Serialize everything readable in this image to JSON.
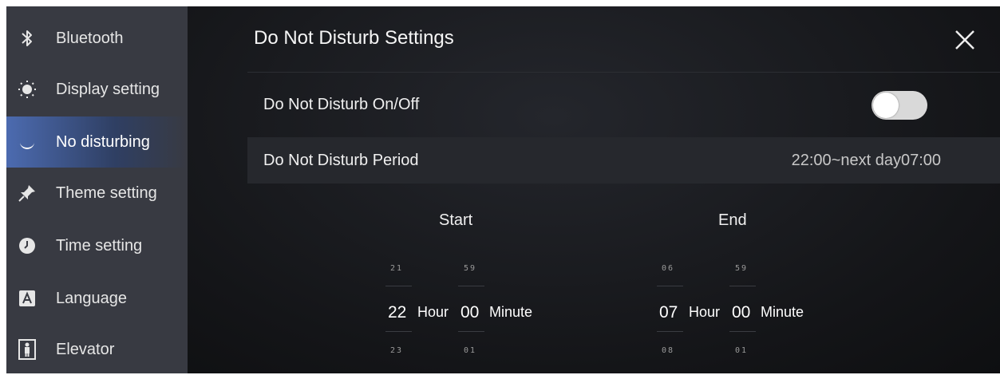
{
  "sidebar": {
    "items": [
      {
        "label": "Bluetooth",
        "icon": "bluetooth-icon"
      },
      {
        "label": "Display setting",
        "icon": "sun-icon"
      },
      {
        "label": "No disturbing",
        "icon": "moon-icon",
        "active": true
      },
      {
        "label": "Theme setting",
        "icon": "pin-icon"
      },
      {
        "label": "Time setting",
        "icon": "clock-icon"
      },
      {
        "label": "Language",
        "icon": "language-icon"
      },
      {
        "label": "Elevator",
        "icon": "elevator-icon"
      }
    ]
  },
  "header": {
    "title": "Do Not Disturb Settings"
  },
  "settings": {
    "toggle_label": "Do Not Disturb On/Off",
    "toggle_on": false,
    "period_label": "Do Not Disturb Period",
    "period_value": "22:00~next day07:00"
  },
  "start": {
    "heading": "Start",
    "hour_prev": "21",
    "hour": "22",
    "hour_next": "23",
    "hour_unit": "Hour",
    "minute_prev": "59",
    "minute": "00",
    "minute_next": "01",
    "minute_unit": "Minute"
  },
  "end": {
    "heading": "End",
    "hour_prev": "06",
    "hour": "07",
    "hour_next": "08",
    "hour_unit": "Hour",
    "minute_prev": "59",
    "minute": "00",
    "minute_next": "01",
    "minute_unit": "Minute"
  },
  "colors": {
    "sidebar_bg": "#383a42",
    "main_bg": "#141518",
    "accent": "#4c6bb0",
    "toggle_off": "#d9d9d9"
  }
}
